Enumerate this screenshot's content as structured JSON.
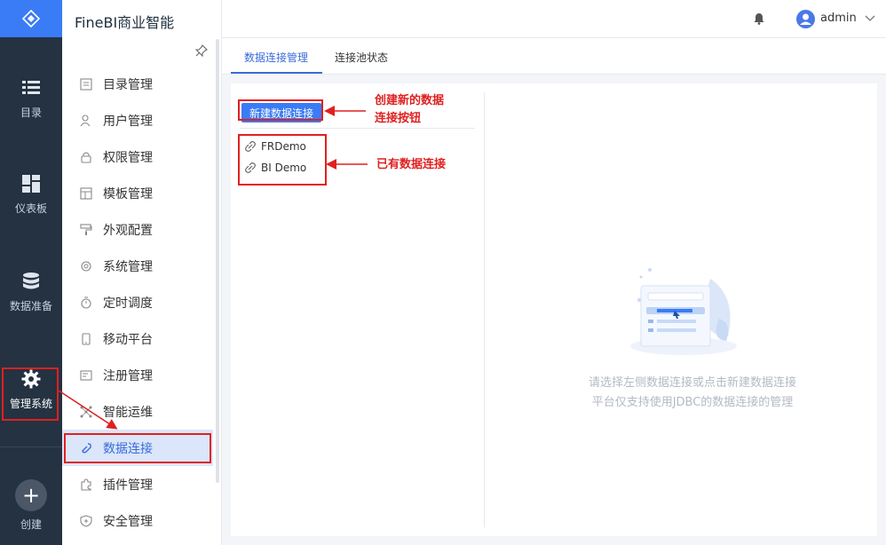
{
  "app": {
    "title": "FineBI商业智能"
  },
  "rail": {
    "items": [
      {
        "label": "目录",
        "icon": "list-icon"
      },
      {
        "label": "仪表板",
        "icon": "dashboard-icon"
      },
      {
        "label": "数据准备",
        "icon": "database-icon"
      },
      {
        "label": "管理系统",
        "icon": "gear-icon"
      }
    ],
    "create_label": "创建"
  },
  "menu": {
    "items": [
      {
        "label": "目录管理",
        "icon": "catalog-icon"
      },
      {
        "label": "用户管理",
        "icon": "user-icon"
      },
      {
        "label": "权限管理",
        "icon": "lock-icon"
      },
      {
        "label": "模板管理",
        "icon": "template-icon"
      },
      {
        "label": "外观配置",
        "icon": "paint-roller-icon"
      },
      {
        "label": "系统管理",
        "icon": "system-gear-icon"
      },
      {
        "label": "定时调度",
        "icon": "timer-icon"
      },
      {
        "label": "移动平台",
        "icon": "mobile-icon"
      },
      {
        "label": "注册管理",
        "icon": "register-icon"
      },
      {
        "label": "智能运维",
        "icon": "ops-icon"
      },
      {
        "label": "数据连接",
        "icon": "link-icon",
        "active": true
      },
      {
        "label": "插件管理",
        "icon": "plugin-icon"
      },
      {
        "label": "安全管理",
        "icon": "shield-icon"
      }
    ]
  },
  "topbar": {
    "user": "admin"
  },
  "tabs": [
    {
      "label": "数据连接管理",
      "active": true
    },
    {
      "label": "连接池状态"
    }
  ],
  "panel": {
    "new_button": "新建数据连接",
    "connections": [
      "FRDemo",
      "BI Demo"
    ],
    "empty_line1": "请选择左侧数据连接或点击新建数据连接",
    "empty_line2": "平台仅支持使用JDBC的数据连接的管理"
  },
  "annotations": {
    "create_line1": "创建新的数据",
    "create_line2": "连接按钮",
    "existing": "已有数据连接"
  },
  "colors": {
    "accent": "#3a7cf5",
    "rail": "#243242",
    "annotation": "#e02020"
  }
}
